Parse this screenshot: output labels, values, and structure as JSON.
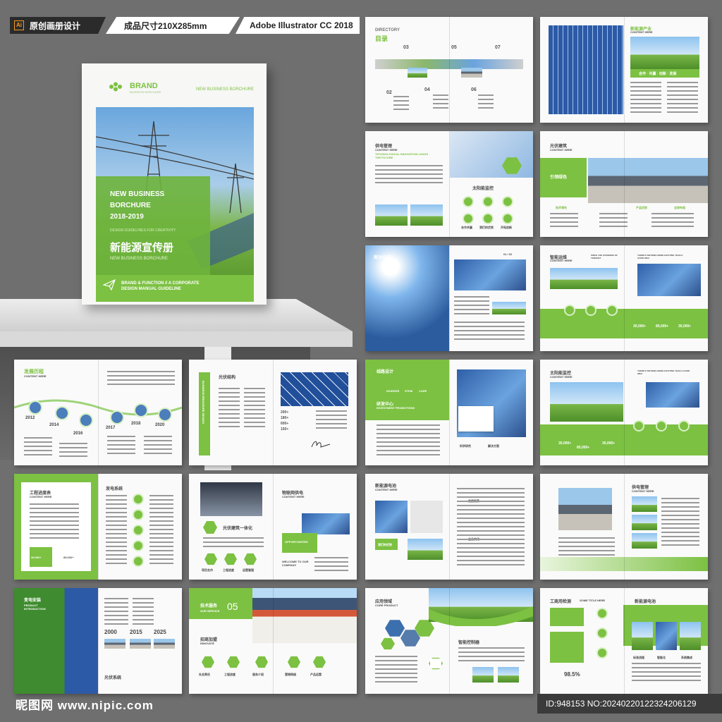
{
  "header": {
    "ai_badge": "Ai",
    "tag1": "原创画册设计",
    "tag2": "成品尺寸210X285mm",
    "tag3": "Adobe Illustrator CC 2018"
  },
  "cover": {
    "brand": "BRAND",
    "brand_sub": "BUSINESS BORCHURE",
    "top_right": "NEW BUSINESS BORCHURE",
    "title_lines": [
      "NEW BUSINESS",
      "BORCHURE",
      "2018-2019"
    ],
    "guideline": "DESIGN GUIDELINES FOR CREATIVITY",
    "cn_title": "新能源宣传册",
    "en_sub": "NEW BUSINESS BORCHURE",
    "func_lines": [
      "BRAND & FUNCTION // A CORPORATE",
      "DESIGN MANUAL GUIDELINE"
    ]
  },
  "spreads": {
    "s1": {
      "directory": "DIRECTORY",
      "mulu": "目录",
      "nums": [
        "01",
        "02",
        "03",
        "04",
        "05",
        "06",
        "07",
        "08"
      ]
    },
    "s2": {
      "title": "新能源产业",
      "sub": "CONTENT HERE",
      "band": "合作 · 共赢 · 创新 · 发展"
    },
    "s3": {
      "title": "供电管理",
      "sub": "CONTENT HERE",
      "tag": "TECHNOLOGICAL INNOVATION LEADS THE FUTURE",
      "right_title": "太阳能监控",
      "labels": [
        "合作共赢",
        "我们的优势",
        "开拓创新",
        "精益求精"
      ]
    },
    "s4": {
      "title": "光伏建筑",
      "sub": "CONTENT HERE",
      "badge": "引领绿色",
      "labels": [
        "技术领先",
        "产品优势",
        "全球布局"
      ]
    },
    "s5": {
      "title": "面对未来",
      "page": "01 / 02"
    },
    "s6": {
      "title": "智能运维",
      "sub": "CONTENT HERE",
      "tag": "SINCE THE FOUNDING OF TENCENT",
      "tag2": "THERE'S NOTHING MORE EXCITING THAN A GOOD IDEA",
      "stat1": "30,000+",
      "stat2": "85,000+",
      "stat3": "30,000+"
    },
    "s7": {
      "title": "发展历程",
      "sub": "CONTENT HERE",
      "years": [
        "2012",
        "2014",
        "2016",
        "2017",
        "2018",
        "2020"
      ]
    },
    "s8": {
      "vertical": "BUSINESS BROCHURE DESIGN",
      "title": "光伏结构",
      "nums": [
        "200+",
        "180+",
        "600+",
        "150+"
      ]
    },
    "s9": {
      "title": "线路设计",
      "cols": [
        "WORKER",
        "STEM",
        "CARE"
      ],
      "sub": "研发中心",
      "sub2": "INVESTMENT PROMOTIONS",
      "labels": [
        "科学研究",
        "解决方案"
      ]
    },
    "s10": {
      "title": "太阳能监控",
      "sub": "CONTENT HERE",
      "tag": "THERE'S NOTHING MORE EXCITING THAN A GOOD IDEA",
      "stat1": "30,000+",
      "stat2": "85,000+",
      "stat3": "30,000+"
    },
    "s11": {
      "title": "工程进度表",
      "sub": "CONTENT HERE",
      "right_title": "发电系统",
      "stat1": "30,000+",
      "stat2": "85,000+"
    },
    "s12": {
      "title": "光伏建筑一体化",
      "right_title": "物联网供电",
      "sub": "CONTENT HERE",
      "opp": "OPPORTUNITIES",
      "welcome": "WELCOME TO OUR COMPANY",
      "labels": [
        "项目合作",
        "工程进度",
        "运营管理"
      ]
    },
    "s13": {
      "title": "新能源电池",
      "sub": "CONTENT HERE",
      "labels": [
        "我们的优势",
        "发展前景",
        "企业文化"
      ]
    },
    "s14": {
      "title": "供电管理",
      "sub": "CONTENT HERE"
    },
    "s15": {
      "title": "变电安装",
      "en": "PRODUCT INTRODUCTION",
      "years": [
        "2000",
        "2015",
        "2025"
      ],
      "bottom": "光伏系统"
    },
    "s16": {
      "title": "技术服务",
      "num": "05",
      "sub": "OUR SERVICE",
      "mid": "招商加盟",
      "mid_en": "INNOVATE",
      "labels": [
        "社会责任",
        "工程进度",
        "服务介绍",
        "营销网络",
        "产品运营"
      ]
    },
    "s17": {
      "title": "应用领域",
      "sub": "CORE PRODUCT",
      "right": "智能控制器"
    },
    "s18": {
      "title": "工商用检测",
      "sub": "SOME TITLE HERE",
      "right_title": "新能源电池",
      "stat": "98.5%",
      "labels": [
        "标准流程",
        "智能化",
        "系统集成"
      ]
    }
  },
  "footer": {
    "watermark": "昵图网 www.nipic.com",
    "id_line": "ID:948153 NO:20240220122324206129"
  }
}
